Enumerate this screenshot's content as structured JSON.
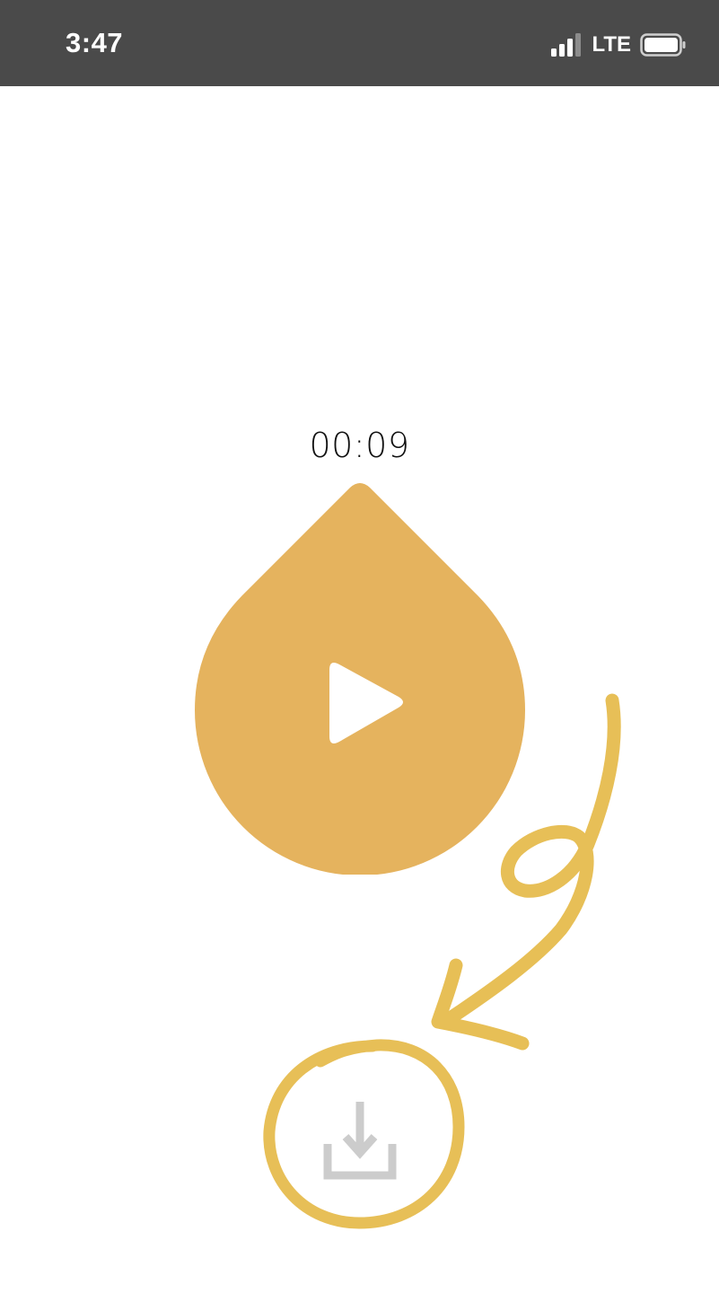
{
  "status_bar": {
    "time": "3:47",
    "network": "LTE",
    "signal_icon": "signal-bars-icon",
    "battery_icon": "battery-icon",
    "background_color": "#4a4a4a"
  },
  "player": {
    "elapsed_time": "00:09",
    "play_icon": "play-icon",
    "accent_color": "#e5b35e"
  },
  "download": {
    "icon": "download-tray-icon",
    "icon_color": "#cccccc"
  },
  "annotation": {
    "arrow_icon": "hand-drawn-arrow",
    "circle_icon": "hand-drawn-circle",
    "color": "#e6bc4e"
  }
}
